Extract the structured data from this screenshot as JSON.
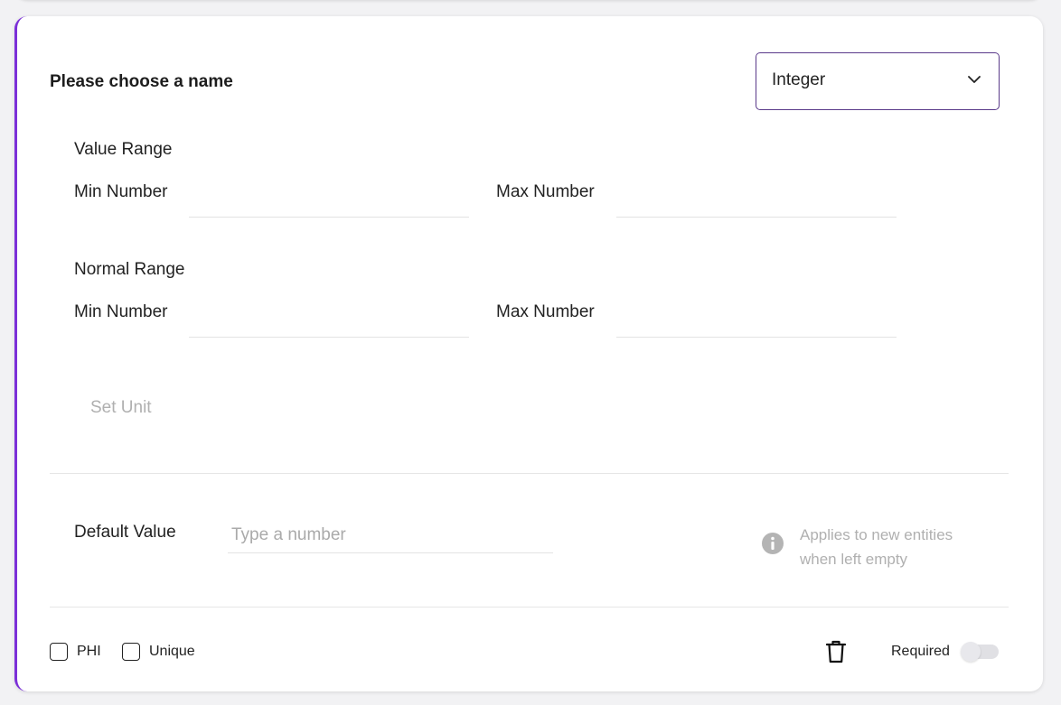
{
  "field": {
    "name_prompt": "Please choose a name",
    "type_selected": "Integer"
  },
  "value_range": {
    "heading": "Value Range",
    "min_label": "Min Number",
    "max_label": "Max Number",
    "min_value": "",
    "max_value": ""
  },
  "normal_range": {
    "heading": "Normal Range",
    "min_label": "Min Number",
    "max_label": "Max Number",
    "min_value": "",
    "max_value": ""
  },
  "unit": {
    "button_label": "Set Unit"
  },
  "default_value": {
    "label": "Default Value",
    "placeholder": "Type a number",
    "value": "",
    "hint_line1": "Applies to new entities",
    "hint_line2": "when left empty"
  },
  "footer": {
    "phi_label": "PHI",
    "unique_label": "Unique",
    "required_label": "Required"
  },
  "colors": {
    "accent": "#7b2fd8",
    "select_border": "#5a3a8a",
    "muted_text": "#b0b0b0"
  },
  "icons": [
    "chevron-down-icon",
    "info-icon",
    "trash-icon"
  ]
}
